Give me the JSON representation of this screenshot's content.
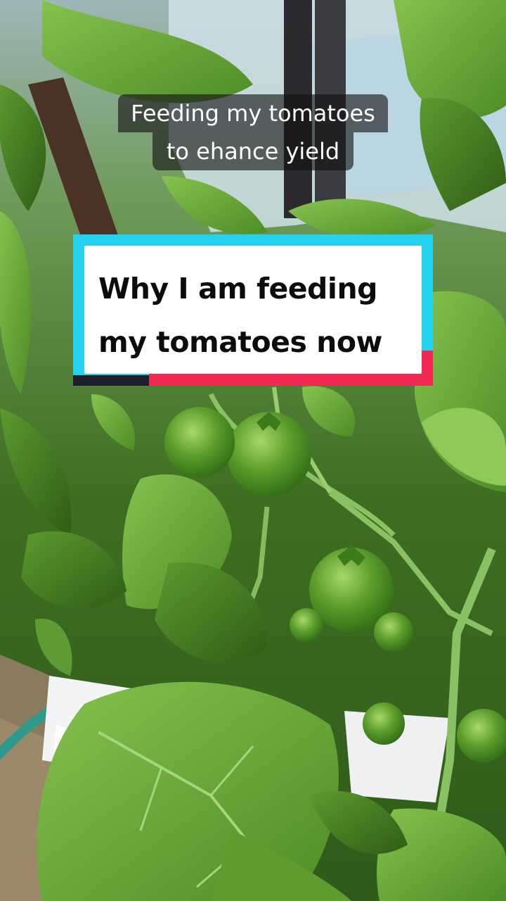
{
  "video": {
    "caption_lines": [
      "Feeding my tomatoes",
      "to ehance yield"
    ],
    "title_lines": [
      "Why I am feeding",
      "my tomatoes now"
    ],
    "colors": {
      "title_accent_cyan": "#23d2ee",
      "title_accent_red": "#f02a52",
      "title_background": "#ffffff",
      "caption_background": "#121212"
    }
  }
}
